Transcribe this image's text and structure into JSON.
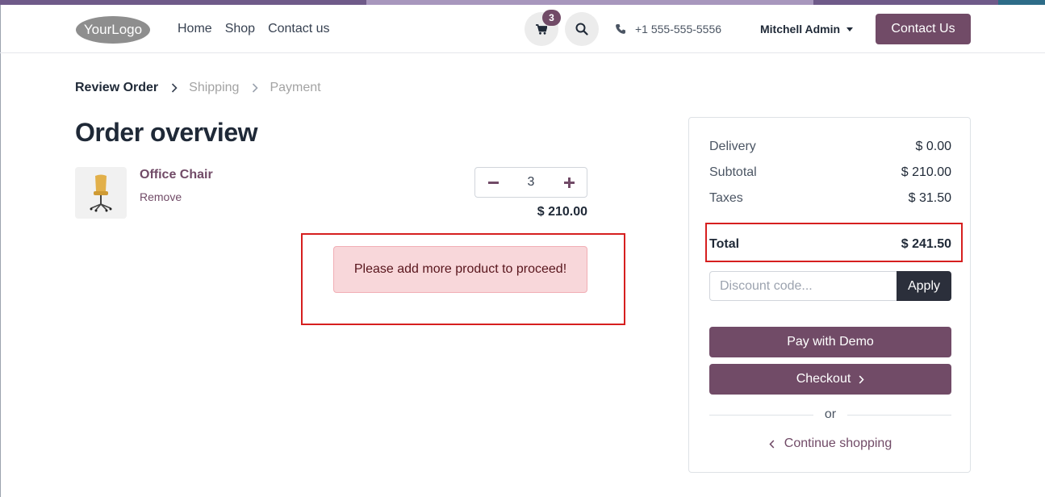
{
  "header": {
    "logo_text": "YourLogo",
    "nav": [
      "Home",
      "Shop",
      "Contact us"
    ],
    "cart_count": "3",
    "phone": "+1 555-555-5556",
    "user": "Mitchell Admin",
    "contact_button": "Contact Us"
  },
  "breadcrumb": {
    "steps": [
      "Review Order",
      "Shipping",
      "Payment"
    ]
  },
  "page": {
    "title": "Order overview"
  },
  "order_line": {
    "product_name": "Office Chair",
    "remove_label": "Remove",
    "quantity": "3",
    "price": "$ 210.00"
  },
  "alert": {
    "message": "Please add more product to proceed!"
  },
  "summary": {
    "delivery_label": "Delivery",
    "delivery_value": "$ 0.00",
    "subtotal_label": "Subtotal",
    "subtotal_value": "$ 210.00",
    "taxes_label": "Taxes",
    "taxes_value": "$ 31.50",
    "total_label": "Total",
    "total_value": "$ 241.50",
    "discount_placeholder": "Discount code...",
    "apply_label": "Apply",
    "pay_label": "Pay with Demo",
    "checkout_label": "Checkout",
    "or_label": "or",
    "continue_label": "Continue shopping"
  },
  "colors": {
    "brand": "#714b67",
    "alert_bg": "#f8d7da",
    "highlight_border": "#d61f1f",
    "apply_bg": "#2b2f3b"
  },
  "icons": [
    "shopping-cart-icon",
    "search-icon",
    "phone-icon",
    "chevron-right-icon",
    "minus-icon",
    "plus-icon",
    "chevron-left-icon",
    "office-chair-image"
  ]
}
